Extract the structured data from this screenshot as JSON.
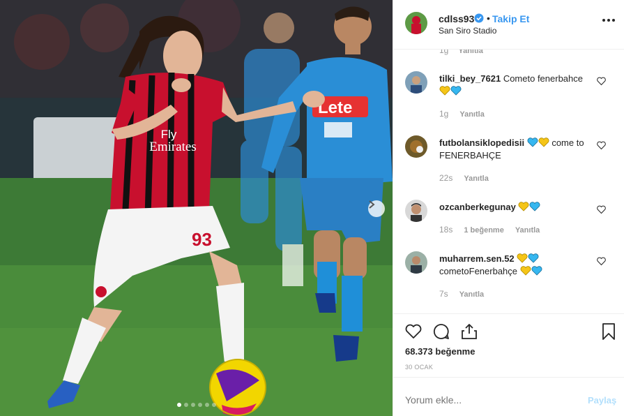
{
  "post": {
    "username": "cdlss93",
    "follow_label": "Takip Et",
    "separator": "•",
    "location": "San Siro Stadio",
    "likes_text": "68.373 beğenme",
    "date_text": "30 OCAK",
    "input_placeholder": "Yorum ekle...",
    "post_label": "Paylaş"
  },
  "photo": {
    "shirt_sponsor_line1": "Fly",
    "shirt_sponsor_line2": "Emirates",
    "player_number": "93",
    "opponent_sponsor": "Lete"
  },
  "previous_comment_meta": {
    "time": "1g",
    "reply": "Yanıtla"
  },
  "comments": [
    {
      "username": "tilki_bey_7621",
      "text_before": "Cometo fenerbahce",
      "text_after": "",
      "emojis_before": [],
      "emojis_after": [
        "yellow-heart",
        "blue-heart"
      ],
      "time": "1g",
      "likes": "",
      "reply": "Yanıtla"
    },
    {
      "username": "futbolansiklopedisii",
      "text_before": "",
      "text_after": "come to FENERBAHÇE",
      "emojis_before": [
        "blue-heart",
        "yellow-heart"
      ],
      "emojis_after": [],
      "time": "22s",
      "likes": "",
      "reply": "Yanıtla"
    },
    {
      "username": "ozcanberkegunay",
      "text_before": "",
      "text_after": "",
      "emojis_before": [],
      "emojis_after": [
        "yellow-heart",
        "blue-heart"
      ],
      "time": "18s",
      "likes": "1 beğenme",
      "reply": "Yanıtla"
    },
    {
      "username": "muharrem.sen.52",
      "text_before": "cometoFenerbahçe",
      "text_after": "",
      "emojis_before": [
        "yellow-heart",
        "blue-heart"
      ],
      "emojis_after": [
        "yellow-heart",
        "blue-heart"
      ],
      "time": "7s",
      "likes": "",
      "reply": "Yanıtla"
    }
  ],
  "colors": {
    "link_blue": "#3897f0",
    "post_disabled": "#b2dffc",
    "heart_yellow": "#f5c518",
    "heart_blue": "#36b7f0",
    "milan_red": "#c8102e",
    "napoli_blue": "#2a8ed6"
  },
  "icons": [
    "verified-badge-icon",
    "more-options-icon",
    "like-icon",
    "comment-icon",
    "share-icon",
    "save-icon",
    "comment-like-icon",
    "next-image-icon"
  ],
  "carousel": {
    "total": 6,
    "active": 1
  }
}
